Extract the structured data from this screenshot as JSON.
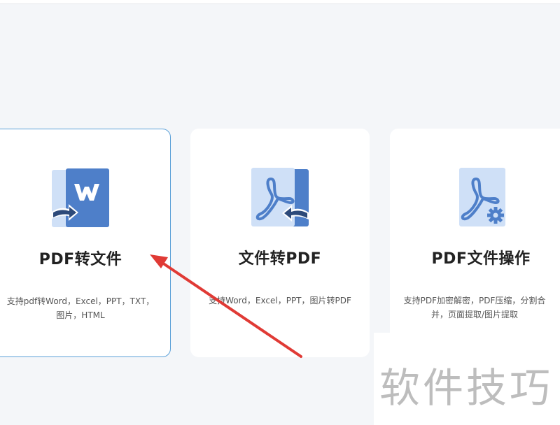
{
  "colors": {
    "accent_border": "#5aa0d8",
    "icon_dark": "#4e7fc9",
    "icon_light": "#cfe0f7",
    "annotation_arrow": "#e03a35"
  },
  "cards": [
    {
      "title": "PDF转文件",
      "desc_line1": "支持pdf转Word，Excel，PPT，TXT，",
      "desc_line2": "图片，HTML",
      "icon": "word-convert-icon",
      "selected": true
    },
    {
      "title": "文件转PDF",
      "desc_line1": "支持Word，Excel，PPT，图片转PDF",
      "icon": "pdf-convert-icon"
    },
    {
      "title": "PDF文件操作",
      "desc_line1": "支持PDF加密解密，PDF压缩，分割合",
      "desc_line2": "并，页面提取/图片提取",
      "icon": "pdf-settings-icon"
    }
  ],
  "watermark": {
    "text": "软件技巧"
  },
  "annotation": {
    "icon": "red-arrow-icon"
  }
}
